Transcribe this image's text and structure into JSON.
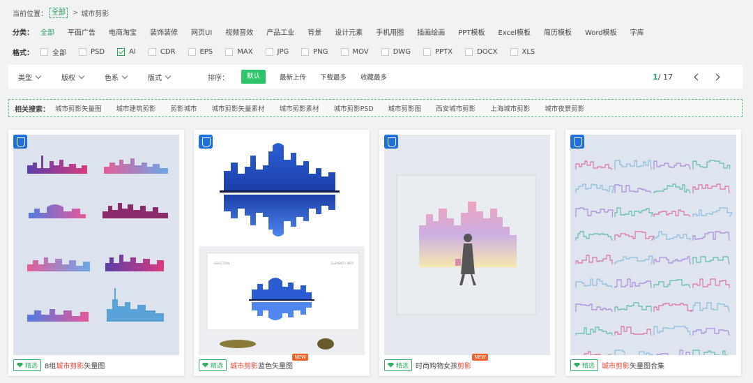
{
  "breadcrumb": {
    "label": "当前位置：",
    "current": "全部",
    "sep": ">",
    "next": "城市剪影"
  },
  "category": {
    "label": "分类：",
    "items": [
      "全部",
      "平面广告",
      "电商淘宝",
      "装饰装修",
      "网页UI",
      "视频音效",
      "产品工业",
      "背景",
      "设计元素",
      "手机用图",
      "插画绘画",
      "PPT模板",
      "Excel模板",
      "简历模板",
      "Word模板",
      "字库"
    ],
    "active_index": 0
  },
  "format": {
    "label": "格式：",
    "items": [
      "全部",
      "PSD",
      "AI",
      "CDR",
      "EPS",
      "MAX",
      "JPG",
      "PNG",
      "MOV",
      "DWG",
      "PPTX",
      "DOCX",
      "XLS"
    ],
    "checked_index": 2
  },
  "filters": {
    "dropdowns": [
      "类型",
      "版权",
      "色系",
      "版式"
    ],
    "sort_label": "排序：",
    "sort_options": [
      "默认",
      "最新上传",
      "下载最多",
      "收藏最多"
    ],
    "sort_active": 0,
    "page_current": "1",
    "page_total": "/ 17"
  },
  "related": {
    "label": "相关搜索：",
    "items": [
      "城市剪影矢量图",
      "城市建筑剪影",
      "剪影城市",
      "城市剪影矢量素材",
      "城市剪影素材",
      "城市剪影PSD",
      "城市剪影图",
      "西安城市剪影",
      "上海城市剪影",
      "城市夜景剪影"
    ]
  },
  "cards": [
    {
      "tag": "精选",
      "title_pre": "8组",
      "title_hl": "城市剪影",
      "title_post": "矢量图",
      "new": ""
    },
    {
      "tag": "精选",
      "title_pre": "",
      "title_hl": "城市剪影",
      "title_post": "蓝色矢量图",
      "new": "NEW"
    },
    {
      "tag": "精选",
      "title_pre": "时尚购物女孩",
      "title_hl": "剪影",
      "title_post": "",
      "new": "NEW"
    },
    {
      "tag": "精选",
      "title_pre": "",
      "title_hl": "城市剪影",
      "title_post": "矢量图合集",
      "new": ""
    }
  ],
  "mockup_text": {
    "left": "SELECTION",
    "right": "ELEMENT / INFO"
  },
  "colors": {
    "accent": "#22a35a",
    "highlight": "#e8412f",
    "new_badge": "#f2632b",
    "shield": "#1e6fd9"
  }
}
